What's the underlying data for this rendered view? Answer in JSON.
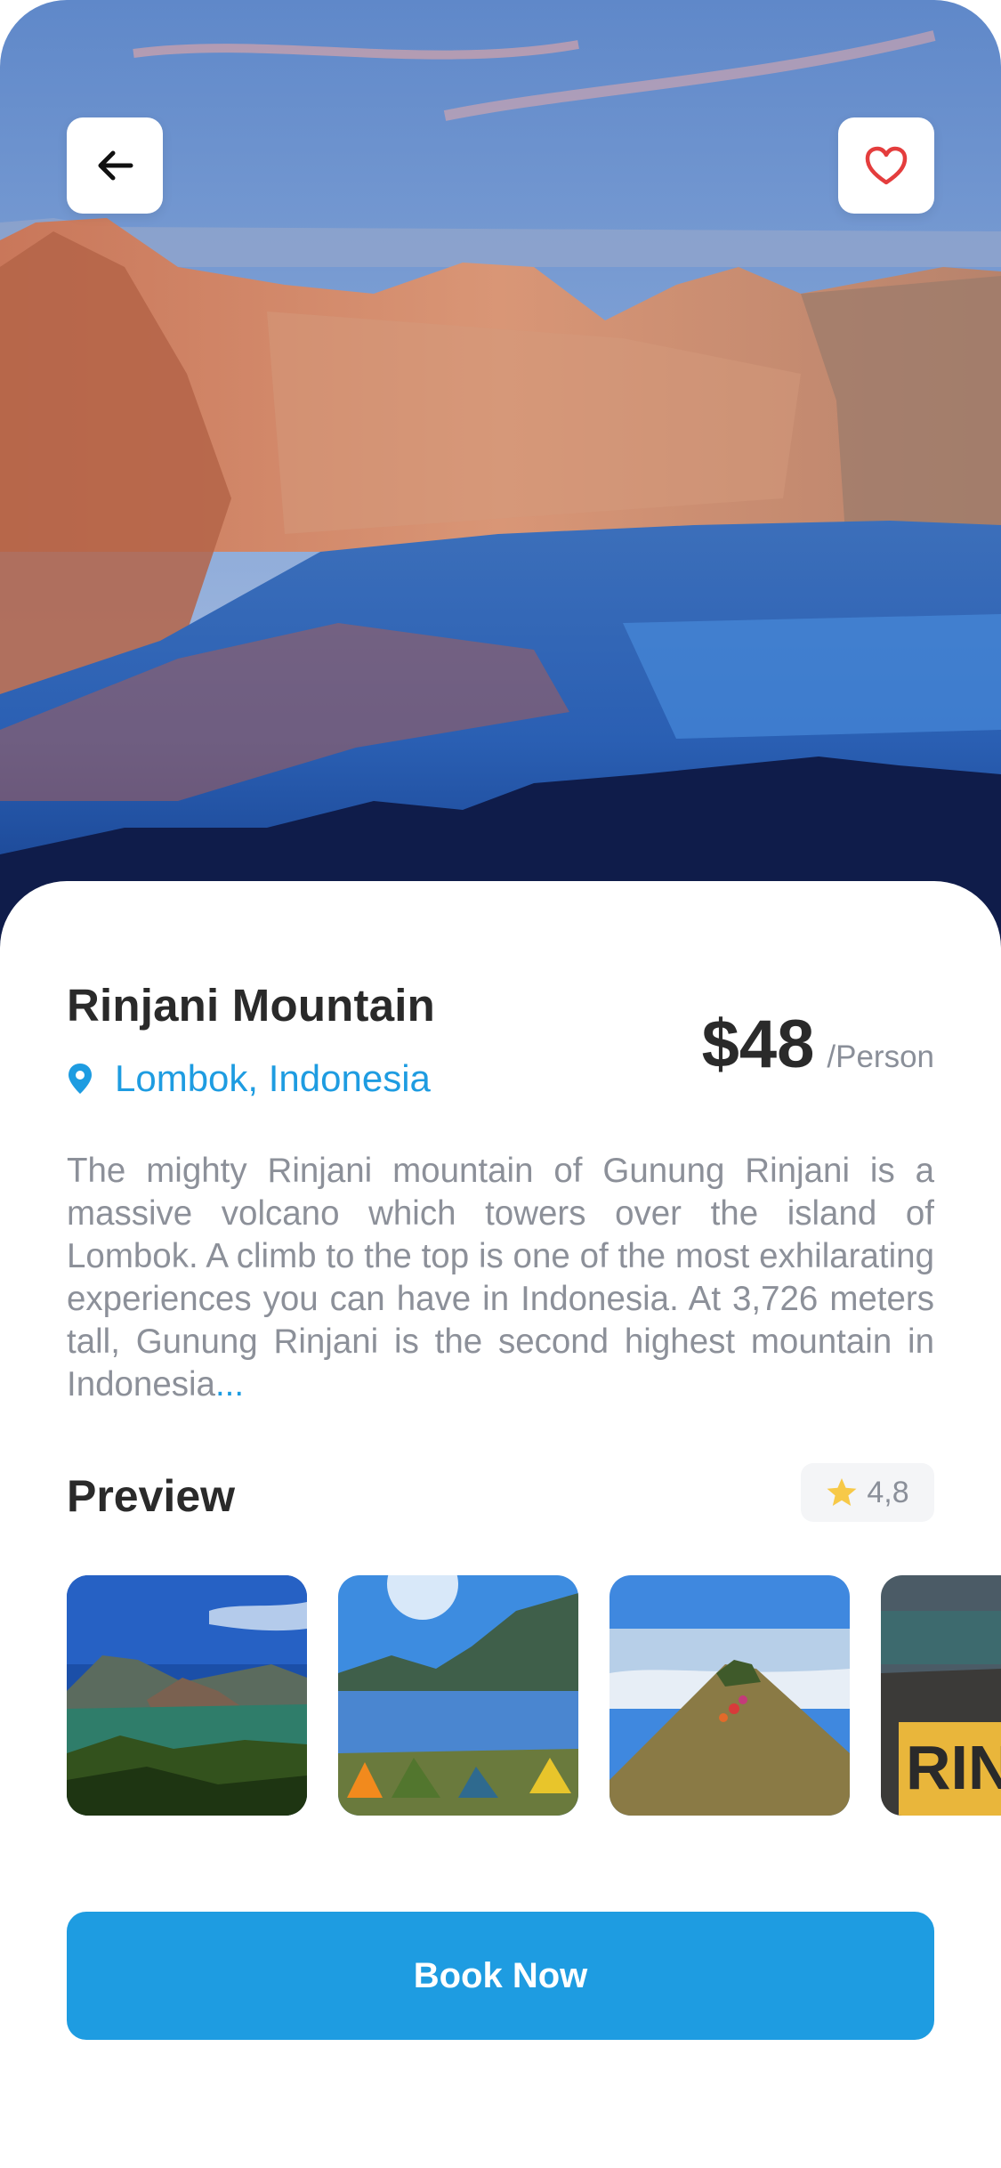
{
  "hero": {
    "back_icon": "arrow-left-icon",
    "favorite_icon": "heart-icon"
  },
  "place": {
    "title": "Rinjani Mountain",
    "location": "Lombok, Indonesia",
    "location_icon": "map-pin-icon",
    "price": "$48",
    "price_unit": "/Person",
    "description": "The mighty Rinjani mountain of Gunung Rinjani is a massive volcano which towers over the island of Lombok. A climb to the top is one of the most exhilarating experiences you can have in Indonesia. At 3,726 meters tall, Gunung Rinjani is the second highest mountain in Indonesia",
    "description_more": "..."
  },
  "preview": {
    "title": "Preview",
    "rating": "4,8",
    "rating_icon": "star-icon"
  },
  "actions": {
    "book_label": "Book Now"
  },
  "colors": {
    "accent": "#1e9ce1",
    "text_dark": "#2a2a2a",
    "text_muted": "#8c9099",
    "star": "#f7c948"
  }
}
